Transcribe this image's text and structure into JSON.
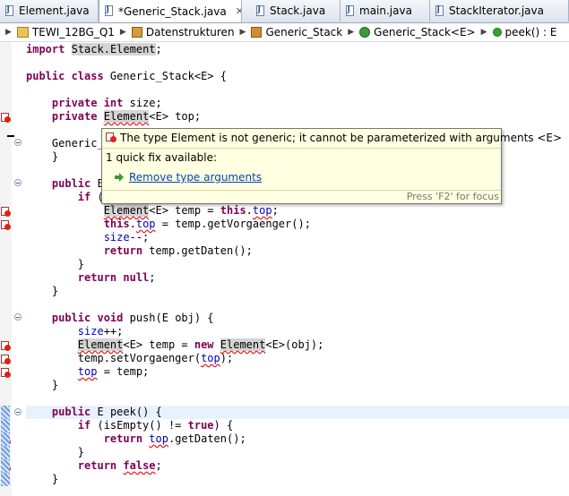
{
  "tabs": [
    {
      "label": "Element.java",
      "active": false,
      "closable": false
    },
    {
      "label": "*Generic_Stack.java",
      "active": true,
      "closable": true
    },
    {
      "label": "Stack.java",
      "active": false,
      "closable": false
    },
    {
      "label": "main.java",
      "active": false,
      "closable": false
    },
    {
      "label": "StackIterator.java",
      "active": false,
      "closable": false
    }
  ],
  "breadcrumb": {
    "project": "TEWI_12BG_Q1",
    "package": "Datenstrukturen",
    "file": "Generic_Stack",
    "class": "Generic_Stack<E>",
    "method": "peek() : E"
  },
  "code": {
    "import_kw": "import",
    "import_target": "Stack.Element",
    "import_end": ";",
    "class_head_1": "public class",
    "class_head_2": " Generic_Stack<E> {",
    "l5_indent": "    ",
    "l5_kw": "private int",
    "l5_name": " size;",
    "l6_indent": "    ",
    "l6_kw": "private",
    "l6_type": "Element",
    "l6_rest": "<E> top;",
    "l8_text": "    Generic_",
    "l9_text": "    }",
    "l11_indent": "    ",
    "l11_kw": "public",
    "l11_rest": " E",
    "l12_indent": "        ",
    "l12_kw": "if",
    "l12_rest": " (",
    "l13_indent": "            ",
    "l13_type": "Element",
    "l13_mid": "<E> temp = ",
    "l13_kw": "this",
    "l13_dot": ".",
    "l13_field": "top",
    "l13_end": ";",
    "l14_indent": "            ",
    "l14_kw": "this",
    "l14_dot": ".",
    "l14_field": "top",
    "l14_rest": " = temp.getVorgaenger();",
    "l15_indent": "            ",
    "l15_field": "size",
    "l15_rest": "--;",
    "l16_indent": "            ",
    "l16_kw": "return",
    "l16_rest": " temp.getDaten();",
    "l17_text": "        }",
    "l18_indent": "        ",
    "l18_kw": "return null",
    "l18_rest": ";",
    "l19_text": "    }",
    "l21_indent": "    ",
    "l21_kw": "public void",
    "l21_rest": " push(E obj) {",
    "l22_indent": "        ",
    "l22_field": "size",
    "l22_rest": "++;",
    "l23_indent": "        ",
    "l23_type": "Element",
    "l23_mid": "<E> temp = ",
    "l23_kw": "new",
    "l23_sp": " ",
    "l23_type2": "Element",
    "l23_rest": "<E>(obj);",
    "l24_indent": "        ",
    "l24_pre": "temp.setVorgaenger(",
    "l24_field": "top",
    "l24_end": ");",
    "l25_indent": "        ",
    "l25_field": "top",
    "l25_rest": " = temp;",
    "l26_text": "    }",
    "l28_indent": "    ",
    "l28_kw": "public",
    "l28_rest": " E peek() {",
    "l29_indent": "        ",
    "l29_kw": "if",
    "l29_mid": " (isEmpty() != ",
    "l29_kw2": "true",
    "l29_rest": ") {",
    "l30_indent": "            ",
    "l30_kw": "return",
    "l30_sp": " ",
    "l30_field": "top",
    "l30_rest": ".getDaten();",
    "l31_text": "        }",
    "l32_indent": "        ",
    "l32_kw": "return",
    "l32_sp": " ",
    "l32_val": "false",
    "l32_end": ";",
    "l33_text": "    }"
  },
  "popup": {
    "message": "The type Element is not generic; it cannot be parameterized with arguments <E>",
    "quickfix_count": "1 quick fix available:",
    "fix_label": "Remove type arguments",
    "footer": "Press 'F2' for focus"
  },
  "colors": {
    "keyword": "#7f0055",
    "field": "#0000c0",
    "error": "#e02020",
    "popup_bg": "#ffffe1",
    "current_line": "#e8f2fe"
  }
}
